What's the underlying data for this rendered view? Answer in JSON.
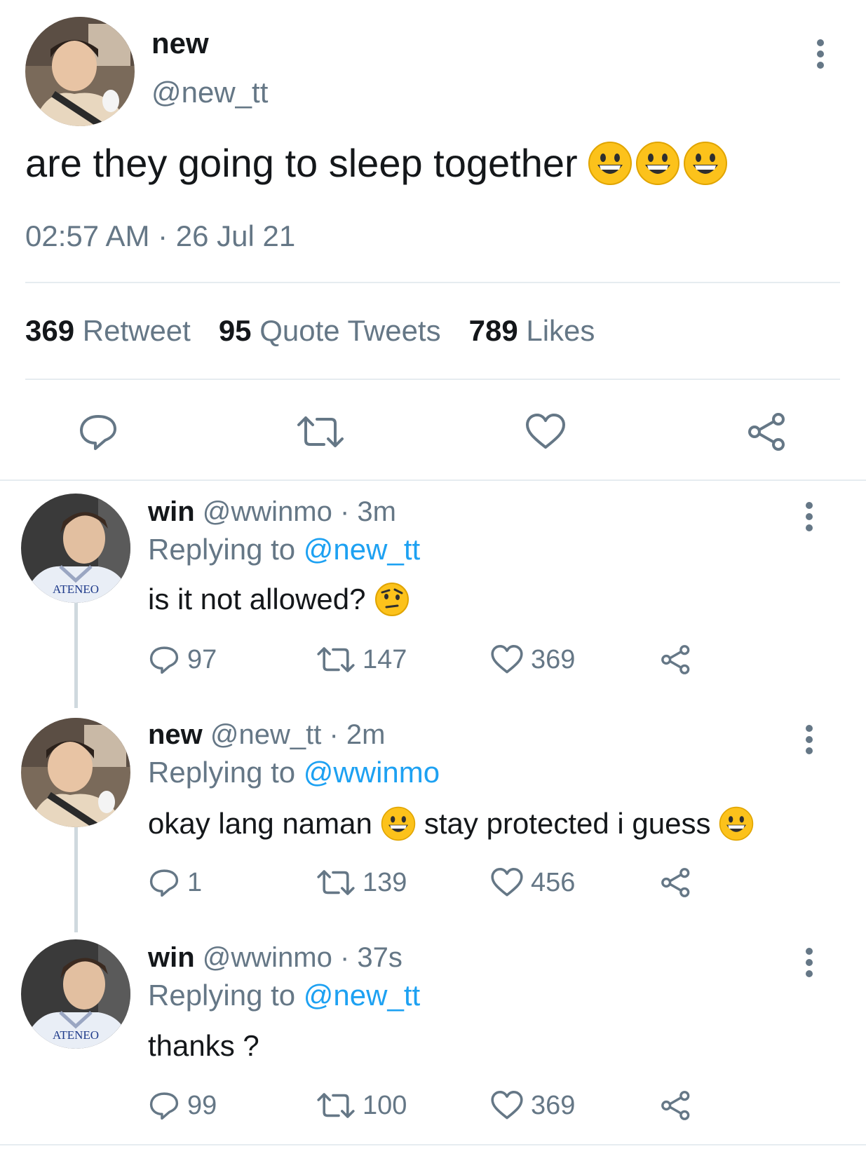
{
  "main_tweet": {
    "name": "new",
    "handle": "@new_tt",
    "text": "are they going to sleep together",
    "emojis": [
      "grinning-face",
      "grinning-face",
      "grinning-face"
    ],
    "timestamp": "02:57 AM · 26 Jul 21",
    "stats": {
      "retweets": "369",
      "retweets_label": "Retweet",
      "quotes": "95",
      "quotes_label": "Quote Tweets",
      "likes": "789",
      "likes_label": "Likes"
    }
  },
  "replies": [
    {
      "name": "win",
      "handle": "@wwinmo · 3m",
      "replying_prefix": "Replying to",
      "replying_to": "@new_tt",
      "text": "is it not allowed?",
      "jersey_text": "ATENEO",
      "replies": "97",
      "retweets": "147",
      "likes": "369"
    },
    {
      "name": "new",
      "handle": "@new_tt · 2m",
      "replying_prefix": "Replying to",
      "replying_to": "@wwinmo",
      "text_a": "okay lang naman",
      "text_b": "stay protected i guess",
      "replies": "1",
      "retweets": "139",
      "likes": "456"
    },
    {
      "name": "win",
      "handle": "@wwinmo · 37s",
      "replying_prefix": "Replying to",
      "replying_to": "@new_tt",
      "text": "thanks ?",
      "jersey_text": "ATENEO",
      "replies": "99",
      "retweets": "100",
      "likes": "369"
    }
  ],
  "colors": {
    "accent": "#1da1f2",
    "muted": "#657786",
    "text": "#14171a",
    "divider": "#e6ecf0",
    "emoji": "#fcc21b"
  }
}
